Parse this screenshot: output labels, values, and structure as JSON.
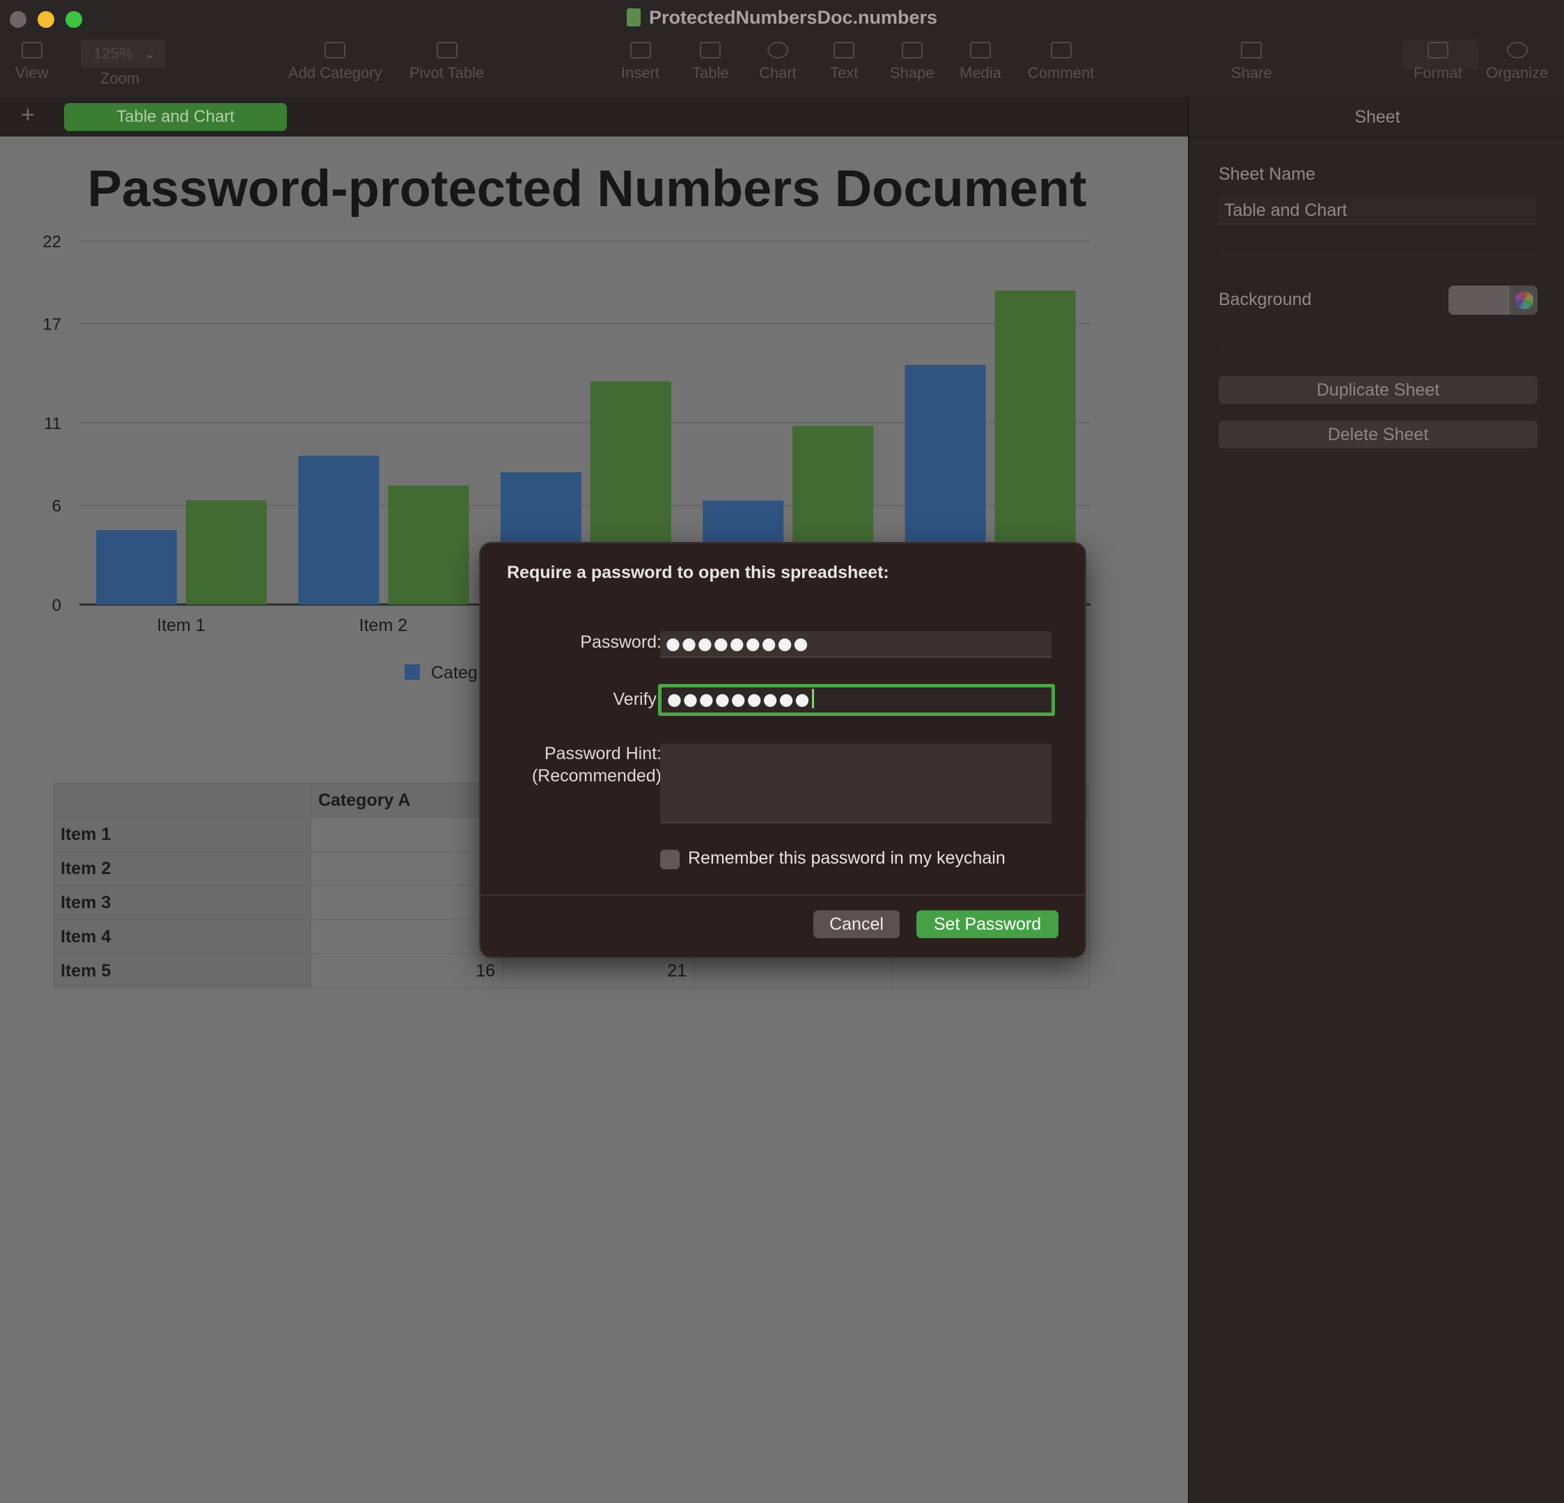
{
  "window": {
    "title": "ProtectedNumbersDoc.numbers"
  },
  "toolbar": {
    "view": "View",
    "zoom_label": "Zoom",
    "zoom_value": "125%",
    "add_category": "Add Category",
    "pivot_table": "Pivot Table",
    "insert": "Insert",
    "table": "Table",
    "chart": "Chart",
    "text": "Text",
    "shape": "Shape",
    "media": "Media",
    "comment": "Comment",
    "share": "Share",
    "format": "Format",
    "organize": "Organize"
  },
  "tabs": {
    "add_symbol": "+",
    "active_sheet": "Table and Chart"
  },
  "document": {
    "heading": "Password-protected Numbers Document"
  },
  "chart_data": {
    "type": "bar",
    "categories": [
      "Item 1",
      "Item 2",
      "Item 3",
      "Item 4",
      "Item 5"
    ],
    "series": [
      {
        "name": "Category A",
        "color": "#2f5480",
        "values": [
          4.5,
          9,
          8,
          6.3,
          14.5
        ]
      },
      {
        "name": "",
        "color": "#426a33",
        "values": [
          6.3,
          7.2,
          13.5,
          10.8,
          19
        ]
      }
    ],
    "y_ticks": [
      0,
      6,
      11,
      17,
      22
    ],
    "ylim": [
      0,
      22
    ],
    "grid": true,
    "legend": "bottom",
    "legend_visible_text": "Categ"
  },
  "table": {
    "header": [
      "",
      "Category A"
    ],
    "rows": [
      {
        "label": "Item 1",
        "a": "",
        "b": ""
      },
      {
        "label": "Item 2",
        "a": "",
        "b": ""
      },
      {
        "label": "Item 3",
        "a": "",
        "b": ""
      },
      {
        "label": "Item 4",
        "a": "",
        "b": ""
      },
      {
        "label": "Item 5",
        "a": "16",
        "b": "21"
      }
    ]
  },
  "inspector": {
    "tab": "Sheet",
    "sheet_name_label": "Sheet Name",
    "sheet_name_value": "Table and Chart",
    "background_label": "Background",
    "duplicate_button": "Duplicate Sheet",
    "delete_button": "Delete Sheet"
  },
  "dialog": {
    "title": "Require a password to open this spreadsheet:",
    "password_label": "Password:",
    "password_value": "●●●●●●●●●",
    "verify_label": "Verify:",
    "verify_value": "●●●●●●●●●",
    "hint_label_line1": "Password Hint:",
    "hint_label_line2": "(Recommended)",
    "hint_value": "",
    "keychain_label": "Remember this password in my keychain",
    "cancel_button": "Cancel",
    "set_button": "Set Password",
    "accent_color": "#45a046"
  }
}
